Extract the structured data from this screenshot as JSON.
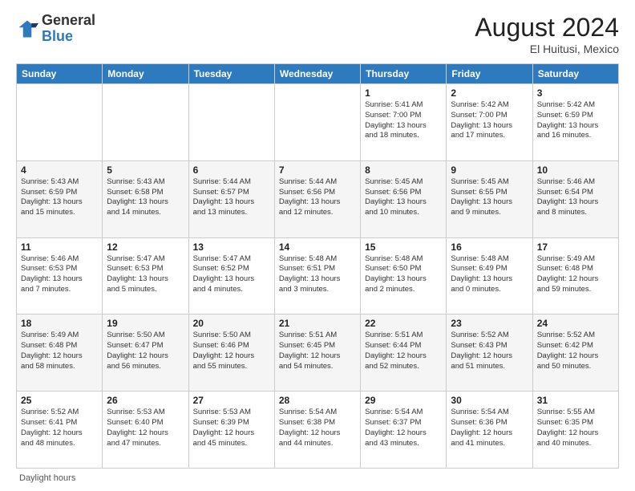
{
  "header": {
    "logo_line1": "General",
    "logo_line2": "Blue",
    "month_year": "August 2024",
    "location": "El Huitusi, Mexico"
  },
  "days_of_week": [
    "Sunday",
    "Monday",
    "Tuesday",
    "Wednesday",
    "Thursday",
    "Friday",
    "Saturday"
  ],
  "weeks": [
    [
      {
        "day": "",
        "info": ""
      },
      {
        "day": "",
        "info": ""
      },
      {
        "day": "",
        "info": ""
      },
      {
        "day": "",
        "info": ""
      },
      {
        "day": "1",
        "info": "Sunrise: 5:41 AM\nSunset: 7:00 PM\nDaylight: 13 hours\nand 18 minutes."
      },
      {
        "day": "2",
        "info": "Sunrise: 5:42 AM\nSunset: 7:00 PM\nDaylight: 13 hours\nand 17 minutes."
      },
      {
        "day": "3",
        "info": "Sunrise: 5:42 AM\nSunset: 6:59 PM\nDaylight: 13 hours\nand 16 minutes."
      }
    ],
    [
      {
        "day": "4",
        "info": "Sunrise: 5:43 AM\nSunset: 6:59 PM\nDaylight: 13 hours\nand 15 minutes."
      },
      {
        "day": "5",
        "info": "Sunrise: 5:43 AM\nSunset: 6:58 PM\nDaylight: 13 hours\nand 14 minutes."
      },
      {
        "day": "6",
        "info": "Sunrise: 5:44 AM\nSunset: 6:57 PM\nDaylight: 13 hours\nand 13 minutes."
      },
      {
        "day": "7",
        "info": "Sunrise: 5:44 AM\nSunset: 6:56 PM\nDaylight: 13 hours\nand 12 minutes."
      },
      {
        "day": "8",
        "info": "Sunrise: 5:45 AM\nSunset: 6:56 PM\nDaylight: 13 hours\nand 10 minutes."
      },
      {
        "day": "9",
        "info": "Sunrise: 5:45 AM\nSunset: 6:55 PM\nDaylight: 13 hours\nand 9 minutes."
      },
      {
        "day": "10",
        "info": "Sunrise: 5:46 AM\nSunset: 6:54 PM\nDaylight: 13 hours\nand 8 minutes."
      }
    ],
    [
      {
        "day": "11",
        "info": "Sunrise: 5:46 AM\nSunset: 6:53 PM\nDaylight: 13 hours\nand 7 minutes."
      },
      {
        "day": "12",
        "info": "Sunrise: 5:47 AM\nSunset: 6:53 PM\nDaylight: 13 hours\nand 5 minutes."
      },
      {
        "day": "13",
        "info": "Sunrise: 5:47 AM\nSunset: 6:52 PM\nDaylight: 13 hours\nand 4 minutes."
      },
      {
        "day": "14",
        "info": "Sunrise: 5:48 AM\nSunset: 6:51 PM\nDaylight: 13 hours\nand 3 minutes."
      },
      {
        "day": "15",
        "info": "Sunrise: 5:48 AM\nSunset: 6:50 PM\nDaylight: 13 hours\nand 2 minutes."
      },
      {
        "day": "16",
        "info": "Sunrise: 5:48 AM\nSunset: 6:49 PM\nDaylight: 13 hours\nand 0 minutes."
      },
      {
        "day": "17",
        "info": "Sunrise: 5:49 AM\nSunset: 6:48 PM\nDaylight: 12 hours\nand 59 minutes."
      }
    ],
    [
      {
        "day": "18",
        "info": "Sunrise: 5:49 AM\nSunset: 6:48 PM\nDaylight: 12 hours\nand 58 minutes."
      },
      {
        "day": "19",
        "info": "Sunrise: 5:50 AM\nSunset: 6:47 PM\nDaylight: 12 hours\nand 56 minutes."
      },
      {
        "day": "20",
        "info": "Sunrise: 5:50 AM\nSunset: 6:46 PM\nDaylight: 12 hours\nand 55 minutes."
      },
      {
        "day": "21",
        "info": "Sunrise: 5:51 AM\nSunset: 6:45 PM\nDaylight: 12 hours\nand 54 minutes."
      },
      {
        "day": "22",
        "info": "Sunrise: 5:51 AM\nSunset: 6:44 PM\nDaylight: 12 hours\nand 52 minutes."
      },
      {
        "day": "23",
        "info": "Sunrise: 5:52 AM\nSunset: 6:43 PM\nDaylight: 12 hours\nand 51 minutes."
      },
      {
        "day": "24",
        "info": "Sunrise: 5:52 AM\nSunset: 6:42 PM\nDaylight: 12 hours\nand 50 minutes."
      }
    ],
    [
      {
        "day": "25",
        "info": "Sunrise: 5:52 AM\nSunset: 6:41 PM\nDaylight: 12 hours\nand 48 minutes."
      },
      {
        "day": "26",
        "info": "Sunrise: 5:53 AM\nSunset: 6:40 PM\nDaylight: 12 hours\nand 47 minutes."
      },
      {
        "day": "27",
        "info": "Sunrise: 5:53 AM\nSunset: 6:39 PM\nDaylight: 12 hours\nand 45 minutes."
      },
      {
        "day": "28",
        "info": "Sunrise: 5:54 AM\nSunset: 6:38 PM\nDaylight: 12 hours\nand 44 minutes."
      },
      {
        "day": "29",
        "info": "Sunrise: 5:54 AM\nSunset: 6:37 PM\nDaylight: 12 hours\nand 43 minutes."
      },
      {
        "day": "30",
        "info": "Sunrise: 5:54 AM\nSunset: 6:36 PM\nDaylight: 12 hours\nand 41 minutes."
      },
      {
        "day": "31",
        "info": "Sunrise: 5:55 AM\nSunset: 6:35 PM\nDaylight: 12 hours\nand 40 minutes."
      }
    ]
  ],
  "footer": {
    "daylight_label": "Daylight hours"
  },
  "colors": {
    "header_bg": "#2e7abf",
    "accent": "#1a6bbf"
  }
}
